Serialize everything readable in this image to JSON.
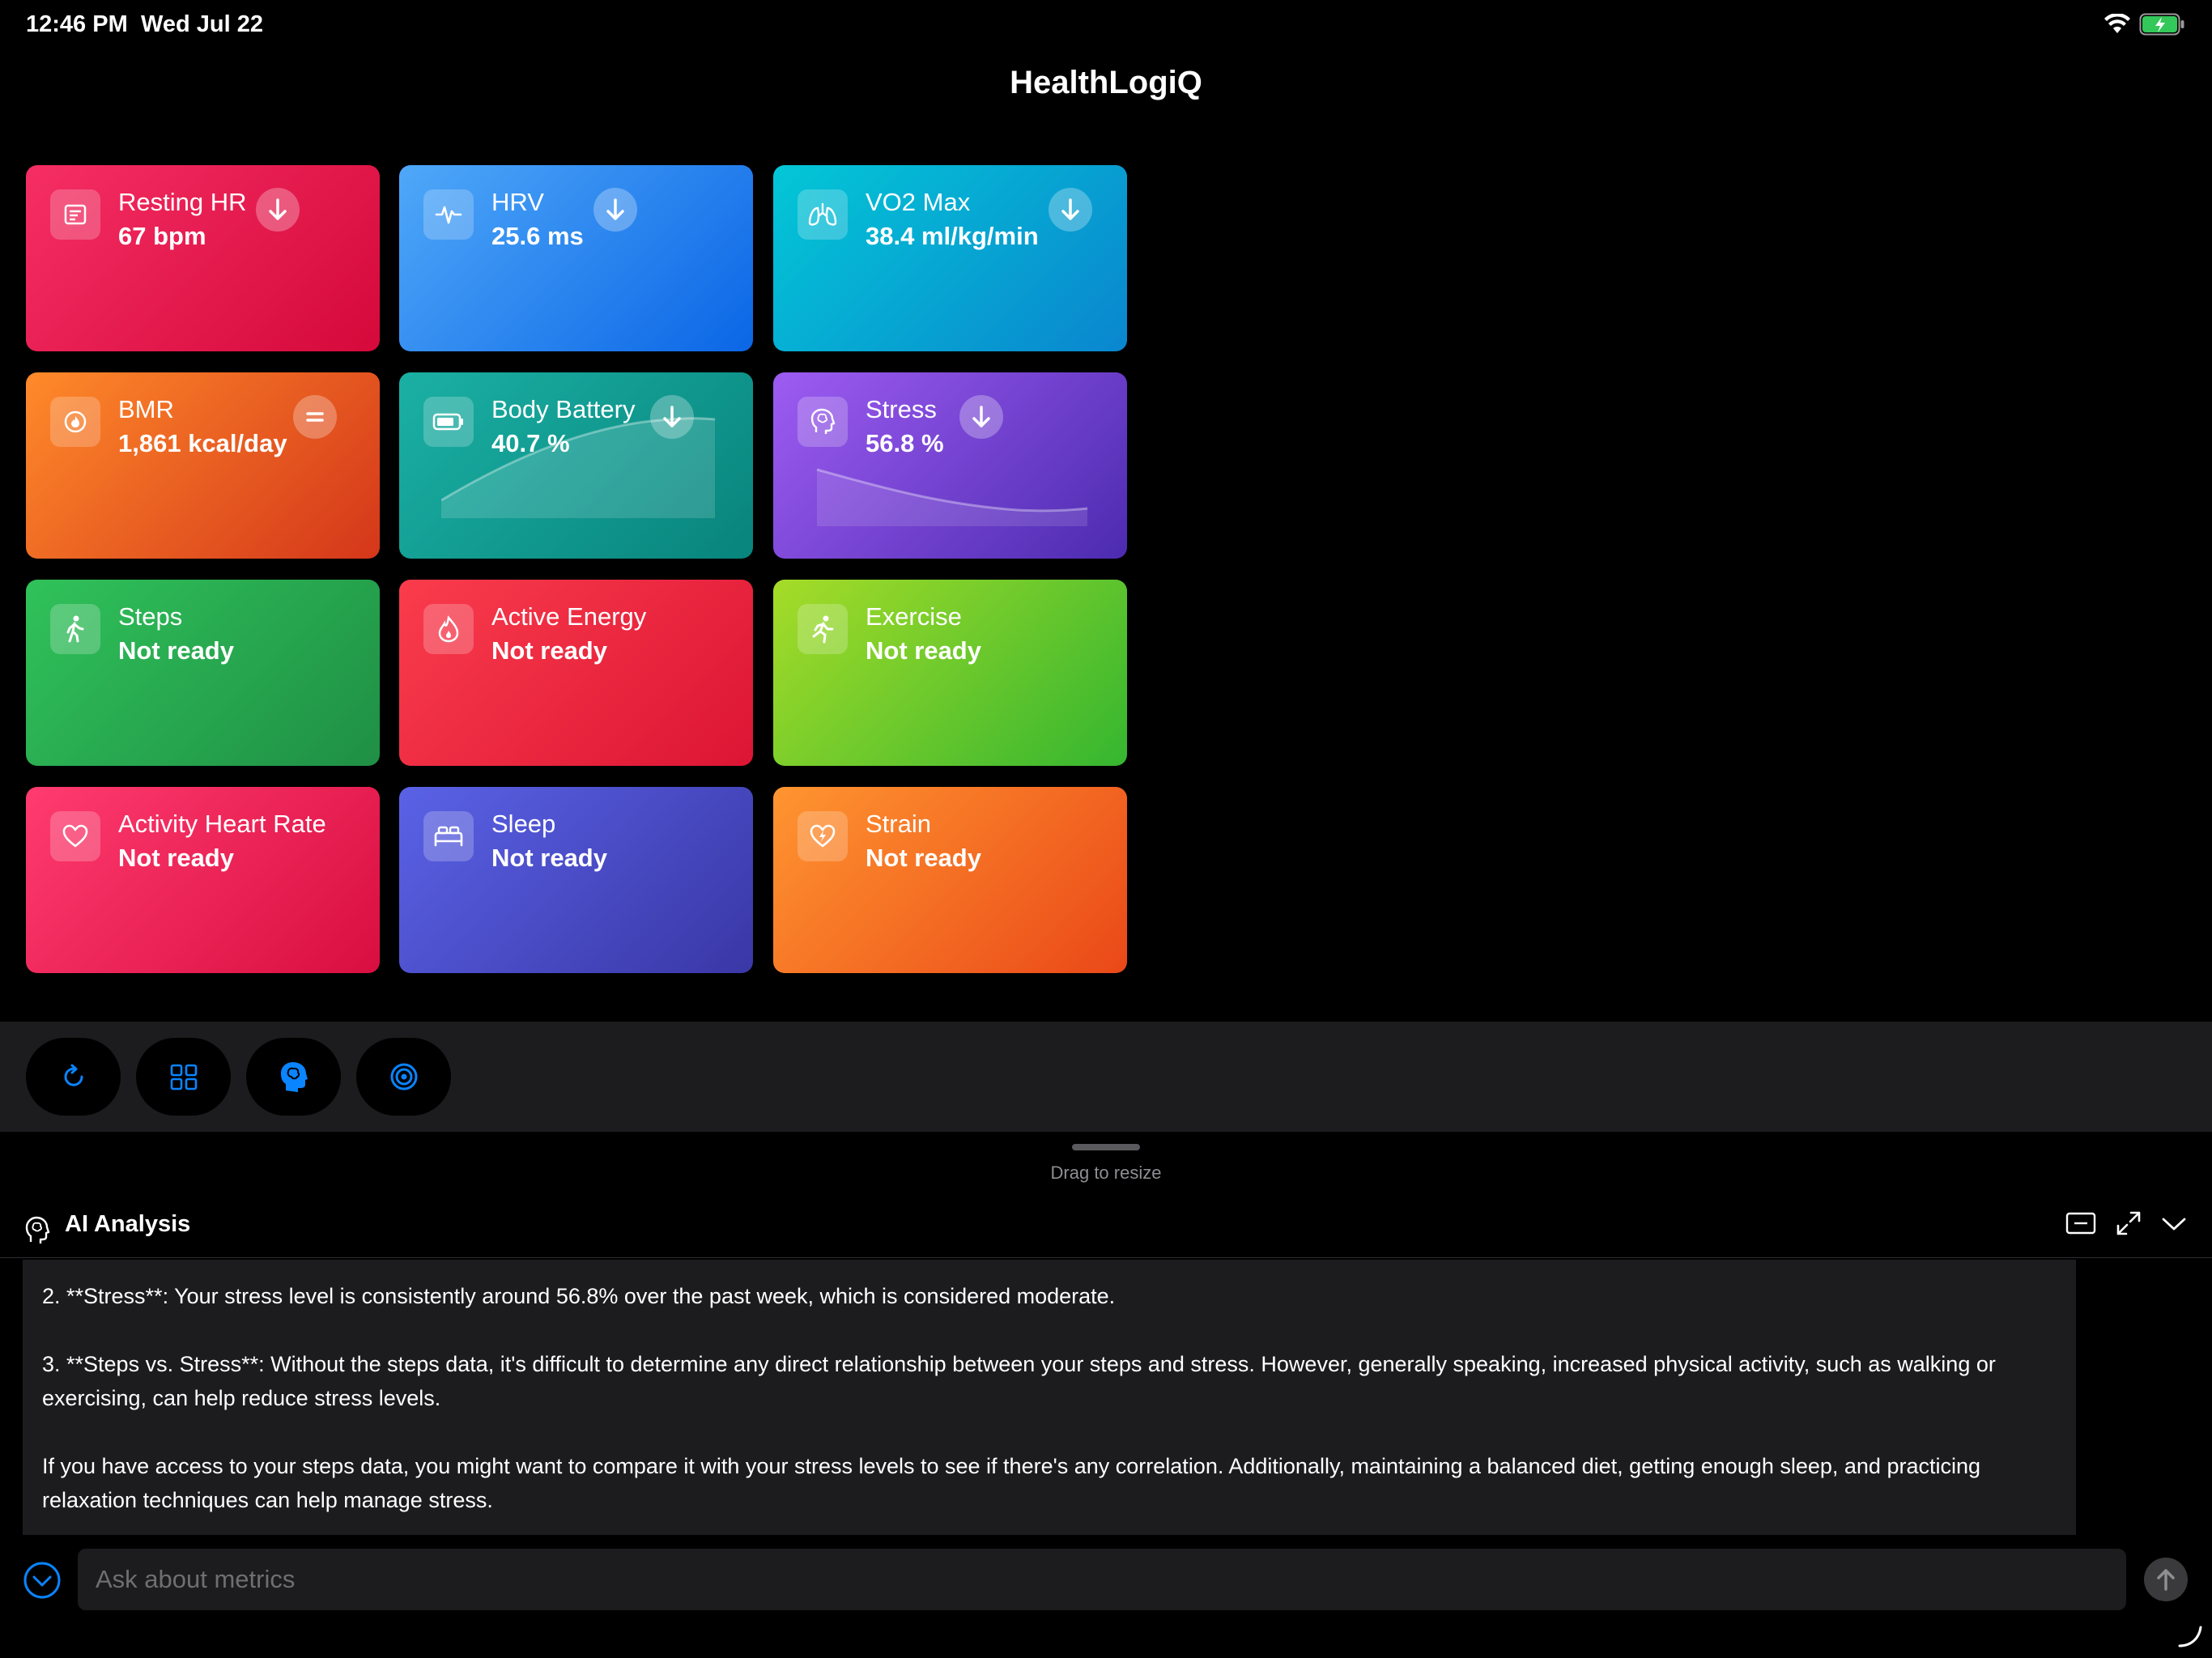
{
  "status_bar": {
    "time": "12:46 PM",
    "date": "Wed Jul 22"
  },
  "app": {
    "title": "HealthLogiQ"
  },
  "tiles": [
    {
      "title": "Resting HR",
      "value": "67 bpm",
      "trend": "down",
      "icon": "heart-monitor-icon",
      "gradient": [
        "#f52e64",
        "#d5093a"
      ]
    },
    {
      "title": "HRV",
      "value": "25.6 ms",
      "trend": "down",
      "icon": "waveform-icon",
      "gradient": [
        "#4fa8f8",
        "#0b66e6"
      ]
    },
    {
      "title": "VO2 Max",
      "value": "38.4 ml/kg/min",
      "trend": "down",
      "icon": "lungs-icon",
      "gradient": [
        "#03c7d6",
        "#0a86cf"
      ]
    },
    {
      "title": "BMR",
      "value": "1,861 kcal/day",
      "trend": "equal",
      "icon": "flame-icon",
      "gradient": [
        "#ff8a2a",
        "#d4361a"
      ]
    },
    {
      "title": "Body Battery",
      "value": "40.7 %",
      "trend": "down",
      "icon": "battery-icon",
      "gradient": [
        "#1bb0a4",
        "#08847c"
      ]
    },
    {
      "title": "Stress",
      "value": "56.8 %",
      "trend": "down",
      "icon": "brain-head-icon",
      "gradient": [
        "#9e5cf2",
        "#4c2bb0"
      ]
    },
    {
      "title": "Steps",
      "value": "Not ready",
      "trend": "",
      "icon": "walking-figure-icon",
      "gradient": [
        "#30c25a",
        "#1f8f45"
      ]
    },
    {
      "title": "Active Energy",
      "value": "Not ready",
      "trend": "",
      "icon": "flame-drop-icon",
      "gradient": [
        "#fa3c4c",
        "#dc1534"
      ]
    },
    {
      "title": "Exercise",
      "value": "Not ready",
      "trend": "",
      "icon": "running-figure-icon",
      "gradient": [
        "#a6dc28",
        "#35b630"
      ]
    },
    {
      "title": "Activity Heart Rate",
      "value": "Not ready",
      "trend": "",
      "icon": "heart-outline-icon",
      "gradient": [
        "#ff3b6f",
        "#d90e40"
      ]
    },
    {
      "title": "Sleep",
      "value": "Not ready",
      "trend": "",
      "icon": "bed-icon",
      "gradient": [
        "#5a62e6",
        "#3a37a6"
      ]
    },
    {
      "title": "Strain",
      "value": "Not ready",
      "trend": "",
      "icon": "heart-bolt-icon",
      "gradient": [
        "#ff9530",
        "#ea4818"
      ]
    }
  ],
  "toolbar": {
    "buttons": [
      {
        "icon": "refresh-icon"
      },
      {
        "icon": "grid-icon"
      },
      {
        "icon": "brain-head-icon"
      },
      {
        "icon": "target-icon"
      }
    ]
  },
  "panel": {
    "resize_label": "Drag to resize",
    "title": "AI Analysis",
    "paragraphs": [
      "2. **Stress**: Your stress level is consistently around 56.8% over the past week, which is considered moderate.",
      "3. **Steps vs. Stress**: Without the steps data, it's difficult to determine any direct relationship between your steps and stress. However, generally speaking, increased physical activity, such as walking or exercising, can help reduce stress levels.",
      "If you have access to your steps data, you might want to compare it with your stress levels to see if there's any correlation. Additionally, maintaining a balanced diet, getting enough sleep, and practicing relaxation techniques can help manage stress."
    ],
    "input_placeholder": "Ask about metrics"
  },
  "colors": {
    "accent": "#0a84ff",
    "background": "#000000",
    "panel": "#1c1c1e"
  }
}
